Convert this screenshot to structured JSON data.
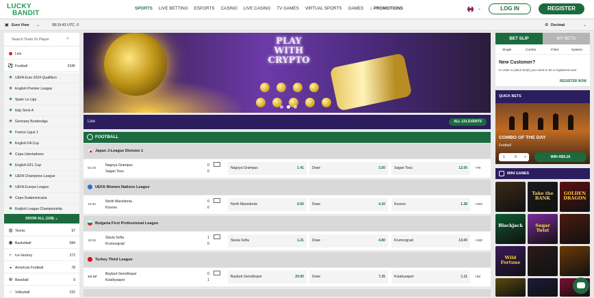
{
  "brand": {
    "line1": "LUCKY",
    "line2": "BANDIT"
  },
  "nav": {
    "items": [
      "SPORTS",
      "LIVE BETTING",
      "ESPORTS",
      "CASINO",
      "LIVE CASINO",
      "TV GAMES",
      "VIRTUAL SPORTS",
      "GAMES"
    ],
    "promotions": "PROMOTIONS",
    "active": "SPORTS"
  },
  "auth": {
    "login": "LOG IN",
    "register": "REGISTER"
  },
  "subbar": {
    "view": "Euro View",
    "clock": "08:19:43 UTC -3",
    "odds_format": "Decimal"
  },
  "sidebar": {
    "search_placeholder": "Search Team Or Player",
    "live": "Live",
    "football": {
      "label": "Football",
      "count": "2345"
    },
    "leagues": [
      "UEFA Euro 2024 Qualifiers",
      "English Premier League",
      "Spain La Liga",
      "Italy Serie A",
      "Germany Bundesliga",
      "France Ligue 1",
      "English FA Cup",
      "Copa Libertadores",
      "English EFL Cup",
      "UEFA Champions League",
      "UEFA Europa League",
      "Copa Sudamericana",
      "English League Championship"
    ],
    "show_all": "SHOW ALL (108)",
    "sports": [
      {
        "label": "Tennis",
        "count": "97",
        "icon": "tennis-icon"
      },
      {
        "label": "Basketball",
        "count": "584",
        "icon": "basketball-icon"
      },
      {
        "label": "Ice Hockey",
        "count": "272",
        "icon": "hockey-icon"
      },
      {
        "label": "American Football",
        "count": "78",
        "icon": "american-football-icon"
      },
      {
        "label": "Baseball",
        "count": "9",
        "icon": "baseball-icon"
      },
      {
        "label": "Volleyball",
        "count": "152",
        "icon": "volleyball-icon"
      }
    ]
  },
  "banner": {
    "line1": "PLAY",
    "line2": "WITH",
    "line3": "CRYPTO"
  },
  "live": {
    "label": "Live",
    "all_events": "ALL 131 EVENTS"
  },
  "sport_header": "FOOTBALL",
  "leagues": [
    {
      "name": "Japan J-League Division 1",
      "flag_color": "#c8102e",
      "match": {
        "time": "52:29",
        "team1": "Nagoya Grampus",
        "team2": "Sagan Tosu",
        "score1": "0",
        "score2": "0",
        "odd1_name": "Nagoya Grampus",
        "odd1": "1.41",
        "oddx_name": "Draw",
        "oddx": "3.50",
        "odd2_name": "Sagan Tosu",
        "odd2": "12.00",
        "more": "+79"
      }
    },
    {
      "name": "UEFA Women Nations League",
      "flag_color": "#2a6fd6",
      "match": {
        "time": "18:30",
        "team1": "North Macedonia",
        "team2": "Kosovo",
        "score1": "0",
        "score2": "0",
        "odd1_name": "North Macedonia",
        "odd1": "9.50",
        "oddx_name": "Draw",
        "oddx": "4.10",
        "odd2_name": "Kosovo",
        "odd2": "1.38",
        "more": "+104"
      }
    },
    {
      "name": "Bulgaria First Professional League",
      "flag_color": "#00966e",
      "match": {
        "time": "18:05",
        "team1": "Slavia Sofia",
        "team2": "Krumovgrad",
        "score1": "1",
        "score2": "0",
        "odd1_name": "Slavia Sofia",
        "odd1": "1.21",
        "oddx_name": "Draw",
        "oddx": "4.80",
        "odd2_name": "Krumovgrad",
        "odd2": "13.00",
        "more": "+100"
      }
    },
    {
      "name": "Turkey Third League",
      "flag_color": "#e30a17",
      "match": {
        "time": "1H 19'",
        "team1": "Bayburt Gencilkspor",
        "team2": "Kutahyaspor",
        "score1": "0",
        "score2": "1",
        "odd1_name": "Bayburt Gencilkspor",
        "odd1": "20.00",
        "oddx_name": "Draw",
        "oddx": "7.25",
        "odd2_name": "Kutahyaspor",
        "odd2": "1.11",
        "more": "+92"
      }
    }
  ],
  "betslip": {
    "tab_slip": "BET SLIP",
    "tab_mybets": "MY BETS",
    "types": [
      "Single",
      "Combo",
      "If Bet",
      "System"
    ],
    "title": "New Customer?",
    "text": "In order to place bet(s) you need to be a registered user",
    "register_now": "REGISTER NOW"
  },
  "quick_bets": {
    "title": "QUICK BETS",
    "combo": "COMBO OF THE DAY",
    "sport": "Football",
    "stake": "1",
    "stake_value": "0",
    "win": "WIN R$9.26"
  },
  "mini_games": {
    "title": "MINI GAMES",
    "tiles": [
      {
        "label": "",
        "bg": "#3a2a18",
        "fg": "#f0c060"
      },
      {
        "label": "Take the BANK",
        "bg": "#1a1a1a",
        "fg": "#f0d070"
      },
      {
        "label": "GOLDEN DRAGON",
        "bg": "#5a1010",
        "fg": "#ffcc40"
      },
      {
        "label": "Blackjack",
        "bg": "#0e5a30",
        "fg": "#ffffff"
      },
      {
        "label": "Sugar Twist",
        "bg": "#7a2a9a",
        "fg": "#ffe040"
      },
      {
        "label": "",
        "bg": "#4a1a10",
        "fg": "#ff9040"
      },
      {
        "label": "Wild Fortune",
        "bg": "#3a1a5a",
        "fg": "#ffd040"
      },
      {
        "label": "",
        "bg": "#2a1a1a",
        "fg": "#ff6060"
      },
      {
        "label": "",
        "bg": "#6a3a08",
        "fg": "#ffd080"
      },
      {
        "label": "",
        "bg": "#5a4a10",
        "fg": "#ffe080"
      },
      {
        "label": "",
        "bg": "#1a1a3a",
        "fg": "#c080ff"
      },
      {
        "label": "",
        "bg": "#7a1030",
        "fg": "#ff80a0"
      }
    ]
  }
}
